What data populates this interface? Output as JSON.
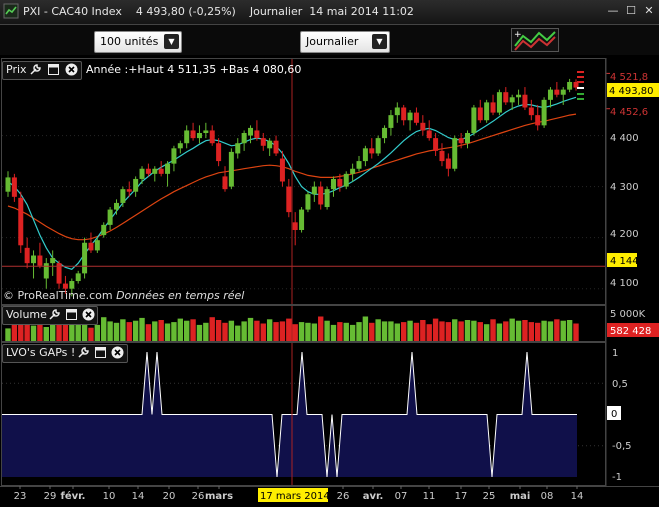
{
  "window": {
    "title_symbol": "PXI - CAC40 Index",
    "title_price": "4 493,80 (-0,25%)",
    "title_period": "Journalier",
    "title_date": "14 mai 2014 11:02"
  },
  "toolbar": {
    "units": "100 unités",
    "period": "Journalier"
  },
  "price_panel": {
    "tag": "Prix",
    "info": "Année :+Haut 4 511,35 +Bas 4 080,60",
    "watermark_brand": "© ProRealTime.com",
    "watermark_text": "Données en temps réel",
    "y_ticks": [
      "4 400",
      "4 300",
      "4 200",
      "4 100"
    ],
    "hi_label": "4 521,8",
    "last_label": "4 493,80",
    "lo_label": "4 452,6",
    "line_label": "4 144"
  },
  "volume_panel": {
    "tag": "Volume",
    "y_ticks": [
      "5 000K"
    ],
    "last_label": "582 428"
  },
  "lvo_panel": {
    "tag": "LVO's GAPs !",
    "y_ticks": [
      "1",
      "0,5",
      "0",
      "-0,5",
      "-1"
    ]
  },
  "xaxis": {
    "labels": [
      "23",
      "29",
      "févr.",
      "10",
      "14",
      "20",
      "26",
      "mars",
      "26",
      "avr.",
      "07",
      "11",
      "17",
      "25",
      "mai",
      "08",
      "14"
    ],
    "cursor_label": "17 mars 2014"
  },
  "colors": {
    "up": "#66bb33",
    "down": "#dd2222",
    "ma_fast": "#33cccc",
    "ma_slow": "#dd4411",
    "lvo_fill": "#10104a",
    "hline": "#b03030",
    "cursor": "#aa2222"
  },
  "chart_data": {
    "type": "candlestick",
    "title": "PXI - CAC40 Index",
    "ylim": [
      4070,
      4550
    ],
    "series": [
      {
        "values": [
          [
            4290,
            4330,
            4280,
            4318
          ],
          [
            4318,
            4325,
            4270,
            4280
          ],
          [
            4278,
            4290,
            4170,
            4185
          ],
          [
            4180,
            4200,
            4140,
            4150
          ],
          [
            4150,
            4175,
            4120,
            4165
          ],
          [
            4165,
            4190,
            4140,
            4145
          ],
          [
            4120,
            4160,
            4100,
            4150
          ],
          [
            4150,
            4175,
            4125,
            4160
          ],
          [
            4150,
            4155,
            4100,
            4110
          ],
          [
            4110,
            4125,
            4090,
            4100
          ],
          [
            4100,
            4120,
            4085,
            4115
          ],
          [
            4115,
            4135,
            4110,
            4130
          ],
          [
            4130,
            4200,
            4120,
            4190
          ],
          [
            4190,
            4210,
            4170,
            4175
          ],
          [
            4175,
            4200,
            4170,
            4195
          ],
          [
            4205,
            4230,
            4200,
            4225
          ],
          [
            4225,
            4260,
            4215,
            4255
          ],
          [
            4255,
            4275,
            4245,
            4268
          ],
          [
            4268,
            4300,
            4260,
            4295
          ],
          [
            4295,
            4310,
            4280,
            4290
          ],
          [
            4290,
            4320,
            4280,
            4315
          ],
          [
            4315,
            4340,
            4305,
            4335
          ],
          [
            4335,
            4345,
            4320,
            4325
          ],
          [
            4325,
            4340,
            4310,
            4335
          ],
          [
            4335,
            4350,
            4320,
            4325
          ],
          [
            4325,
            4350,
            4300,
            4345
          ],
          [
            4345,
            4380,
            4330,
            4375
          ],
          [
            4375,
            4390,
            4365,
            4385
          ],
          [
            4385,
            4420,
            4375,
            4410
          ],
          [
            4410,
            4425,
            4390,
            4395
          ],
          [
            4395,
            4420,
            4385,
            4405
          ],
          [
            4405,
            4425,
            4395,
            4410
          ],
          [
            4410,
            4420,
            4380,
            4385
          ],
          [
            4385,
            4395,
            4340,
            4350
          ],
          [
            4320,
            4340,
            4290,
            4295
          ],
          [
            4300,
            4375,
            4295,
            4368
          ],
          [
            4365,
            4395,
            4355,
            4385
          ],
          [
            4385,
            4410,
            4370,
            4405
          ],
          [
            4400,
            4420,
            4385,
            4415
          ],
          [
            4410,
            4430,
            4390,
            4395
          ],
          [
            4395,
            4405,
            4370,
            4380
          ],
          [
            4375,
            4395,
            4360,
            4390
          ],
          [
            4390,
            4400,
            4360,
            4365
          ],
          [
            4355,
            4370,
            4300,
            4310
          ],
          [
            4300,
            4315,
            4240,
            4250
          ],
          [
            4230,
            4250,
            4185,
            4215
          ],
          [
            4215,
            4260,
            4210,
            4255
          ],
          [
            4255,
            4290,
            4250,
            4285
          ],
          [
            4285,
            4310,
            4270,
            4300
          ],
          [
            4300,
            4310,
            4255,
            4265
          ],
          [
            4260,
            4300,
            4255,
            4295
          ],
          [
            4295,
            4320,
            4280,
            4315
          ],
          [
            4315,
            4325,
            4290,
            4300
          ],
          [
            4300,
            4330,
            4295,
            4325
          ],
          [
            4325,
            4345,
            4310,
            4335
          ],
          [
            4335,
            4360,
            4330,
            4350
          ],
          [
            4350,
            4380,
            4340,
            4375
          ],
          [
            4375,
            4395,
            4355,
            4365
          ],
          [
            4365,
            4400,
            4360,
            4395
          ],
          [
            4395,
            4420,
            4385,
            4415
          ],
          [
            4415,
            4450,
            4400,
            4440
          ],
          [
            4440,
            4465,
            4425,
            4455
          ],
          [
            4455,
            4460,
            4420,
            4430
          ],
          [
            4430,
            4450,
            4410,
            4445
          ],
          [
            4445,
            4455,
            4420,
            4425
          ],
          [
            4425,
            4440,
            4400,
            4410
          ],
          [
            4410,
            4430,
            4390,
            4395
          ],
          [
            4395,
            4405,
            4360,
            4370
          ],
          [
            4370,
            4385,
            4340,
            4350
          ],
          [
            4355,
            4365,
            4320,
            4335
          ],
          [
            4335,
            4400,
            4330,
            4395
          ],
          [
            4395,
            4405,
            4375,
            4385
          ],
          [
            4385,
            4410,
            4375,
            4405
          ],
          [
            4405,
            4460,
            4400,
            4455
          ],
          [
            4455,
            4470,
            4425,
            4430
          ],
          [
            4430,
            4470,
            4425,
            4465
          ],
          [
            4465,
            4480,
            4440,
            4445
          ],
          [
            4445,
            4490,
            4440,
            4485
          ],
          [
            4485,
            4495,
            4460,
            4465
          ],
          [
            4465,
            4480,
            4450,
            4475
          ],
          [
            4475,
            4490,
            4460,
            4480
          ],
          [
            4480,
            4495,
            4450,
            4455
          ],
          [
            4455,
            4470,
            4430,
            4440
          ],
          [
            4440,
            4460,
            4410,
            4420
          ],
          [
            4420,
            4475,
            4415,
            4470
          ],
          [
            4470,
            4495,
            4455,
            4490
          ],
          [
            4490,
            4505,
            4475,
            4480
          ],
          [
            4480,
            4495,
            4460,
            4490
          ],
          [
            4490,
            4511,
            4485,
            4505
          ],
          [
            4505,
            4510,
            4488,
            4494
          ]
        ]
      }
    ],
    "ma_fast": [
      4310,
      4300,
      4285,
      4265,
      4235,
      4205,
      4180,
      4160,
      4150,
      4142,
      4138,
      4150,
      4168,
      4185,
      4200,
      4218,
      4235,
      4252,
      4268,
      4282,
      4295,
      4310,
      4320,
      4330,
      4338,
      4345,
      4352,
      4360,
      4368,
      4375,
      4383,
      4390,
      4392,
      4390,
      4385,
      4380,
      4382,
      4387,
      4392,
      4395,
      4393,
      4388,
      4380,
      4365,
      4345,
      4320,
      4300,
      4290,
      4285,
      4285,
      4287,
      4292,
      4298,
      4303,
      4310,
      4318,
      4327,
      4336,
      4345,
      4355,
      4366,
      4378,
      4390,
      4400,
      4408,
      4412,
      4414,
      4410,
      4403,
      4396,
      4392,
      4392,
      4397,
      4404,
      4412,
      4420,
      4428,
      4437,
      4446,
      4453,
      4458,
      4461,
      4460,
      4457,
      4455,
      4458,
      4462,
      4467,
      4471,
      4475
    ],
    "ma_slow": [
      4262,
      4258,
      4252,
      4246,
      4238,
      4230,
      4222,
      4215,
      4208,
      4202,
      4198,
      4196,
      4196,
      4198,
      4202,
      4207,
      4213,
      4220,
      4228,
      4236,
      4244,
      4252,
      4260,
      4268,
      4276,
      4283,
      4290,
      4296,
      4302,
      4308,
      4314,
      4319,
      4323,
      4327,
      4329,
      4331,
      4333,
      4335,
      4337,
      4339,
      4341,
      4342,
      4341,
      4339,
      4335,
      4330,
      4326,
      4322,
      4320,
      4318,
      4318,
      4318,
      4320,
      4322,
      4325,
      4328,
      4332,
      4336,
      4340,
      4344,
      4348,
      4352,
      4356,
      4360,
      4364,
      4367,
      4370,
      4372,
      4374,
      4376,
      4378,
      4381,
      4384,
      4388,
      4392,
      4396,
      4400,
      4404,
      4408,
      4412,
      4416,
      4420,
      4423,
      4426,
      4428,
      4431,
      4434,
      4437,
      4440,
      4442
    ],
    "volume": [
      1800,
      2600,
      3400,
      2900,
      2200,
      3100,
      2000,
      2700,
      3000,
      2400,
      2900,
      3200,
      2500,
      1900,
      2300,
      3400,
      2800,
      2600,
      3100,
      2700,
      2900,
      3300,
      2400,
      2800,
      3000,
      2500,
      2700,
      3200,
      2900,
      3100,
      2300,
      2600,
      3400,
      3000,
      2600,
      2900,
      2200,
      2800,
      3300,
      2900,
      2500,
      3100,
      2700,
      2800,
      3200,
      2400,
      2700,
      2600,
      2500,
      3500,
      2900,
      2300,
      2700,
      2600,
      2300,
      2700,
      3500,
      2600,
      3100,
      2800,
      2800,
      2500,
      2700,
      2900,
      2600,
      3000,
      2400,
      3200,
      2800,
      2700,
      3100,
      2800,
      3000,
      2900,
      2700,
      2400,
      3100,
      2500,
      2800,
      3200,
      2900,
      3000,
      2700,
      2600,
      2900,
      2800,
      3100,
      2900,
      3000,
      2500
    ],
    "lvo": [
      0,
      0,
      0,
      0,
      0,
      0,
      0,
      0,
      0,
      0,
      0,
      0,
      0,
      0,
      0,
      0,
      0,
      0,
      0,
      0,
      0,
      0,
      0,
      0,
      0,
      0,
      0,
      0,
      0,
      1,
      0,
      1,
      0,
      0,
      0,
      0,
      0,
      0,
      0,
      0,
      0,
      0,
      0,
      0,
      0,
      0,
      0,
      0,
      0,
      0,
      0,
      0,
      0,
      0,
      0,
      -1,
      0,
      0,
      0,
      0,
      1,
      0,
      0,
      0,
      0,
      -1,
      0,
      -1,
      0,
      0,
      0,
      0,
      0,
      0,
      0,
      0,
      0,
      0,
      0,
      0,
      0,
      0,
      1,
      0,
      0,
      0,
      0,
      0,
      0,
      0,
      0,
      0,
      0,
      0,
      0,
      0,
      0,
      0,
      -1,
      0,
      0,
      0,
      0,
      0,
      0,
      1,
      0,
      0,
      0,
      0,
      0,
      0,
      0,
      0,
      0,
      0
    ]
  }
}
